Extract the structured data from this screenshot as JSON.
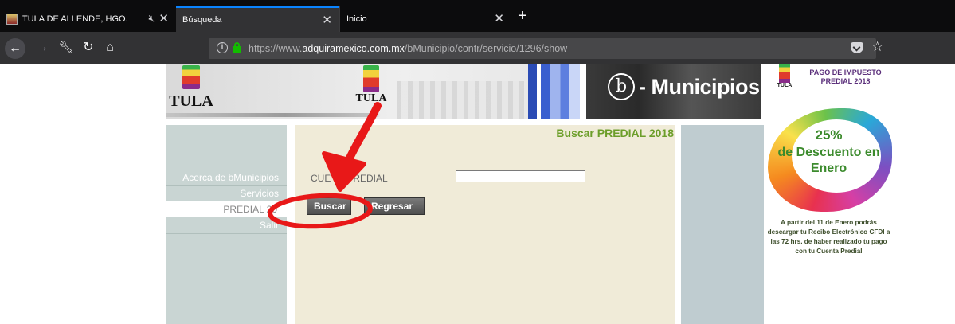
{
  "browser": {
    "tabs": [
      {
        "title": "TULA DE ALLENDE, HGO.",
        "close": "✕"
      },
      {
        "title": "Búsqueda",
        "close": "✕"
      },
      {
        "title": "Inicio",
        "close": "✕"
      }
    ],
    "new_tab": "+",
    "url_prefix": "https://www.",
    "url_domain": "adquiramexico.com.mx",
    "url_path": "/bMunicipio/contr/servicio/1296/show",
    "url_more": "···",
    "url_info": "i"
  },
  "header": {
    "logo_left_name": "TULA",
    "logo_center_name": "TULA",
    "banner_icon": "b",
    "banner_title": "- Municipios"
  },
  "sidebar": {
    "items": [
      {
        "label": "Acerca de bMunicipios"
      },
      {
        "label": "Servicios"
      },
      {
        "label": "PREDIAL 20"
      },
      {
        "label": "Salir"
      }
    ]
  },
  "content": {
    "title": "Buscar PREDIAL 2018",
    "field_label": "CUE      PREDIAL",
    "field_value": "",
    "search_button": "Buscar",
    "back_button": "Regresar"
  },
  "promo": {
    "logo_name": "TULA",
    "heading": "PAGO DE IMPUESTO PREDIAL 2018",
    "percent": "25%",
    "discount": "de Descuento en Enero",
    "footer": "A partir del 11 de Enero podrás descargar tu Recibo Electrónico CFDI a las 72 hrs. de haber realizado tu pago con tu Cuenta Predial"
  },
  "colors": {
    "annotation": "#e81818",
    "title_green": "#6c9e2a",
    "content_bg": "#f0ebd8",
    "sidebar_bg": "#c9d5d3"
  }
}
